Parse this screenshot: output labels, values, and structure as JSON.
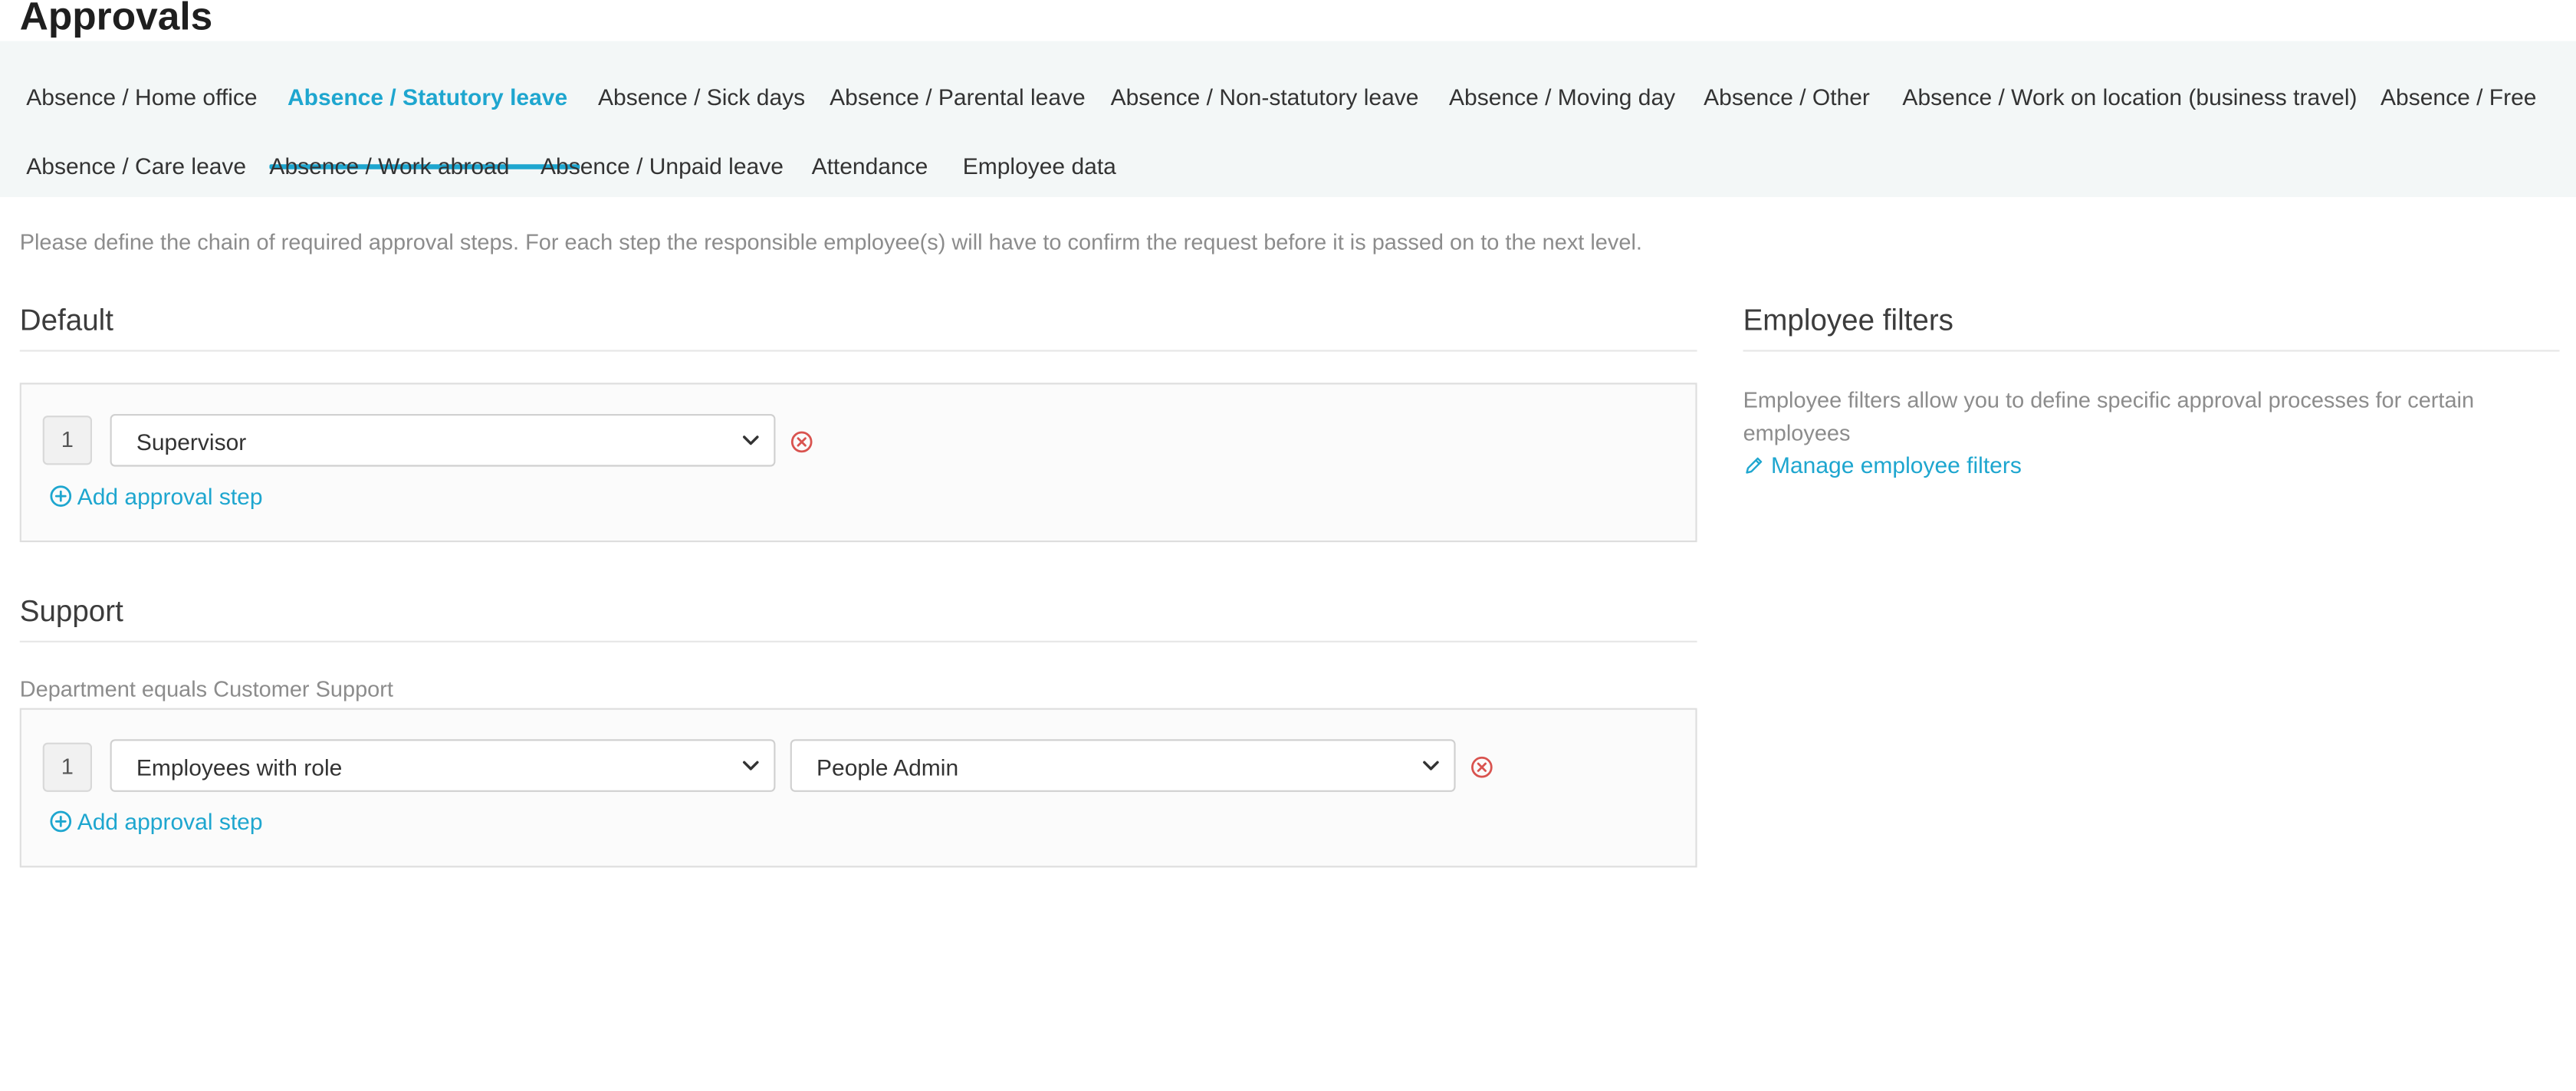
{
  "page": {
    "title": "Approvals"
  },
  "tabs": [
    {
      "label": "Absence / Home office",
      "active": false
    },
    {
      "label": "Absence / Statutory leave",
      "active": true
    },
    {
      "label": "Absence / Sick days",
      "active": false
    },
    {
      "label": "Absence / Parental leave",
      "active": false
    },
    {
      "label": "Absence / Non-statutory leave",
      "active": false
    },
    {
      "label": "Absence / Moving day",
      "active": false
    },
    {
      "label": "Absence / Other",
      "active": false
    },
    {
      "label": "Absence / Work on location (business travel)",
      "active": false
    },
    {
      "label": "Absence / Free",
      "active": false
    },
    {
      "label": "Absence / Care leave",
      "active": false
    },
    {
      "label": "Absence / Work abroad",
      "active": false
    },
    {
      "label": "Absence / Unpaid leave",
      "active": false
    },
    {
      "label": "Attendance",
      "active": false
    },
    {
      "label": "Employee data",
      "active": false
    }
  ],
  "intro": "Please define the chain of required approval steps. For each step the responsible employee(s) will have to confirm the request before it is passed on to the next level.",
  "sections": {
    "default": {
      "title": "Default",
      "steps": [
        {
          "number": "1",
          "approver": "Supervisor"
        }
      ],
      "add_label": "Add approval step"
    },
    "support": {
      "title": "Support",
      "condition": "Department equals Customer Support",
      "steps": [
        {
          "number": "1",
          "approver": "Employees with role",
          "role": "People Admin"
        }
      ],
      "add_label": "Add approval step"
    }
  },
  "filters": {
    "title": "Employee filters",
    "description": "Employee filters allow you to define specific approval processes for certain employees",
    "manage_label": "Manage employee filters"
  },
  "colors": {
    "accent": "#1ea6cf",
    "danger": "#d9534f",
    "tabbar_bg": "#f3f7f7",
    "muted_text": "#8c8c8c"
  },
  "icons": {
    "remove": "x-circle-icon",
    "add": "plus-circle-icon",
    "edit": "pencil-icon",
    "dropdown": "chevron-down-icon"
  }
}
